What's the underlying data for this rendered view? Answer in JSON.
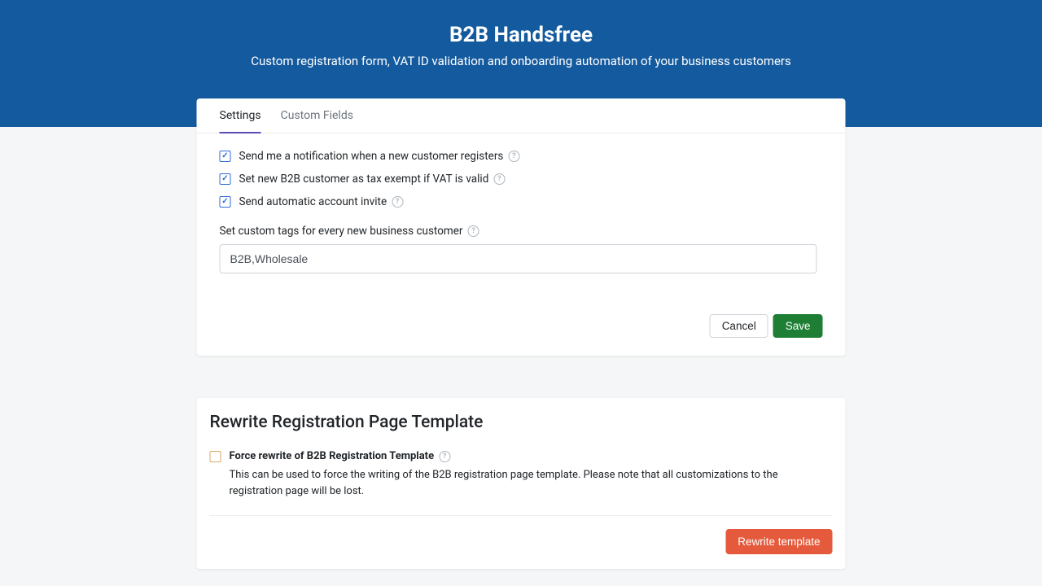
{
  "header": {
    "title": "B2B Handsfree",
    "subtitle": "Custom registration form, VAT ID validation and onboarding automation of your business customers"
  },
  "tabs": {
    "settings": "Settings",
    "custom_fields": "Custom Fields"
  },
  "settings": {
    "notify_label": "Send me a notification when a new customer registers",
    "tax_exempt_label": "Set new B2B customer as tax exempt if VAT is valid",
    "auto_invite_label": "Send automatic account invite",
    "custom_tags_label": "Set custom tags for every new business customer",
    "custom_tags_value": "B2B,Wholesale"
  },
  "buttons": {
    "cancel": "Cancel",
    "save": "Save",
    "rewrite": "Rewrite template"
  },
  "rewrite": {
    "title": "Rewrite Registration Page Template",
    "force_label": "Force rewrite of B2B Registration Template",
    "desc": "This can be used to force the writing of the B2B registration page template. Please note that all customizations to the registration page will be lost."
  }
}
